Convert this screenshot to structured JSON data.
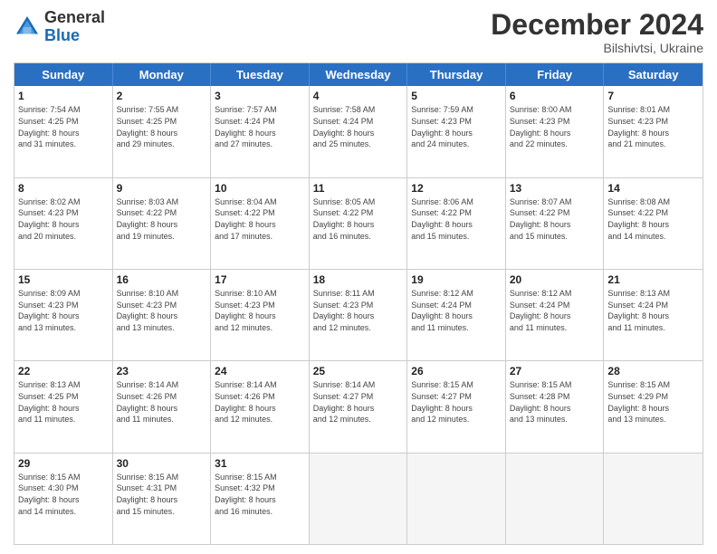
{
  "header": {
    "logo_general": "General",
    "logo_blue": "Blue",
    "month_title": "December 2024",
    "location": "Bilshivtsi, Ukraine"
  },
  "days_of_week": [
    "Sunday",
    "Monday",
    "Tuesday",
    "Wednesday",
    "Thursday",
    "Friday",
    "Saturday"
  ],
  "weeks": [
    [
      {
        "day": "1",
        "info": "Sunrise: 7:54 AM\nSunset: 4:25 PM\nDaylight: 8 hours\nand 31 minutes."
      },
      {
        "day": "2",
        "info": "Sunrise: 7:55 AM\nSunset: 4:25 PM\nDaylight: 8 hours\nand 29 minutes."
      },
      {
        "day": "3",
        "info": "Sunrise: 7:57 AM\nSunset: 4:24 PM\nDaylight: 8 hours\nand 27 minutes."
      },
      {
        "day": "4",
        "info": "Sunrise: 7:58 AM\nSunset: 4:24 PM\nDaylight: 8 hours\nand 25 minutes."
      },
      {
        "day": "5",
        "info": "Sunrise: 7:59 AM\nSunset: 4:23 PM\nDaylight: 8 hours\nand 24 minutes."
      },
      {
        "day": "6",
        "info": "Sunrise: 8:00 AM\nSunset: 4:23 PM\nDaylight: 8 hours\nand 22 minutes."
      },
      {
        "day": "7",
        "info": "Sunrise: 8:01 AM\nSunset: 4:23 PM\nDaylight: 8 hours\nand 21 minutes."
      }
    ],
    [
      {
        "day": "8",
        "info": "Sunrise: 8:02 AM\nSunset: 4:23 PM\nDaylight: 8 hours\nand 20 minutes."
      },
      {
        "day": "9",
        "info": "Sunrise: 8:03 AM\nSunset: 4:22 PM\nDaylight: 8 hours\nand 19 minutes."
      },
      {
        "day": "10",
        "info": "Sunrise: 8:04 AM\nSunset: 4:22 PM\nDaylight: 8 hours\nand 17 minutes."
      },
      {
        "day": "11",
        "info": "Sunrise: 8:05 AM\nSunset: 4:22 PM\nDaylight: 8 hours\nand 16 minutes."
      },
      {
        "day": "12",
        "info": "Sunrise: 8:06 AM\nSunset: 4:22 PM\nDaylight: 8 hours\nand 15 minutes."
      },
      {
        "day": "13",
        "info": "Sunrise: 8:07 AM\nSunset: 4:22 PM\nDaylight: 8 hours\nand 15 minutes."
      },
      {
        "day": "14",
        "info": "Sunrise: 8:08 AM\nSunset: 4:22 PM\nDaylight: 8 hours\nand 14 minutes."
      }
    ],
    [
      {
        "day": "15",
        "info": "Sunrise: 8:09 AM\nSunset: 4:23 PM\nDaylight: 8 hours\nand 13 minutes."
      },
      {
        "day": "16",
        "info": "Sunrise: 8:10 AM\nSunset: 4:23 PM\nDaylight: 8 hours\nand 13 minutes."
      },
      {
        "day": "17",
        "info": "Sunrise: 8:10 AM\nSunset: 4:23 PM\nDaylight: 8 hours\nand 12 minutes."
      },
      {
        "day": "18",
        "info": "Sunrise: 8:11 AM\nSunset: 4:23 PM\nDaylight: 8 hours\nand 12 minutes."
      },
      {
        "day": "19",
        "info": "Sunrise: 8:12 AM\nSunset: 4:24 PM\nDaylight: 8 hours\nand 11 minutes."
      },
      {
        "day": "20",
        "info": "Sunrise: 8:12 AM\nSunset: 4:24 PM\nDaylight: 8 hours\nand 11 minutes."
      },
      {
        "day": "21",
        "info": "Sunrise: 8:13 AM\nSunset: 4:24 PM\nDaylight: 8 hours\nand 11 minutes."
      }
    ],
    [
      {
        "day": "22",
        "info": "Sunrise: 8:13 AM\nSunset: 4:25 PM\nDaylight: 8 hours\nand 11 minutes."
      },
      {
        "day": "23",
        "info": "Sunrise: 8:14 AM\nSunset: 4:26 PM\nDaylight: 8 hours\nand 11 minutes."
      },
      {
        "day": "24",
        "info": "Sunrise: 8:14 AM\nSunset: 4:26 PM\nDaylight: 8 hours\nand 12 minutes."
      },
      {
        "day": "25",
        "info": "Sunrise: 8:14 AM\nSunset: 4:27 PM\nDaylight: 8 hours\nand 12 minutes."
      },
      {
        "day": "26",
        "info": "Sunrise: 8:15 AM\nSunset: 4:27 PM\nDaylight: 8 hours\nand 12 minutes."
      },
      {
        "day": "27",
        "info": "Sunrise: 8:15 AM\nSunset: 4:28 PM\nDaylight: 8 hours\nand 13 minutes."
      },
      {
        "day": "28",
        "info": "Sunrise: 8:15 AM\nSunset: 4:29 PM\nDaylight: 8 hours\nand 13 minutes."
      }
    ],
    [
      {
        "day": "29",
        "info": "Sunrise: 8:15 AM\nSunset: 4:30 PM\nDaylight: 8 hours\nand 14 minutes."
      },
      {
        "day": "30",
        "info": "Sunrise: 8:15 AM\nSunset: 4:31 PM\nDaylight: 8 hours\nand 15 minutes."
      },
      {
        "day": "31",
        "info": "Sunrise: 8:15 AM\nSunset: 4:32 PM\nDaylight: 8 hours\nand 16 minutes."
      },
      {
        "day": "",
        "info": ""
      },
      {
        "day": "",
        "info": ""
      },
      {
        "day": "",
        "info": ""
      },
      {
        "day": "",
        "info": ""
      }
    ]
  ]
}
